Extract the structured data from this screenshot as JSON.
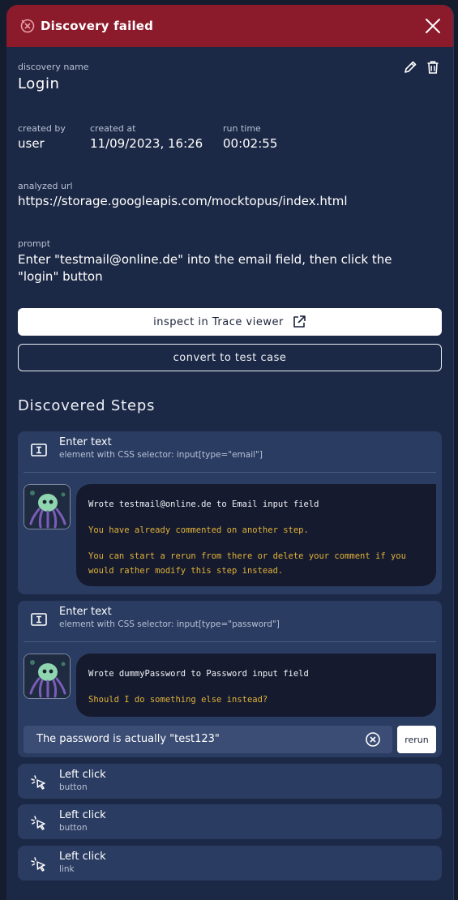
{
  "header": {
    "title": "Discovery failed",
    "fail_icon": "failed-circle-icon",
    "close_icon": "close-icon"
  },
  "discovery": {
    "name_label": "discovery name",
    "name": "Login",
    "created_by_label": "created by",
    "created_by": "user",
    "created_at_label": "created at",
    "created_at": "11/09/2023, 16:26",
    "run_time_label": "run time",
    "run_time": "00:02:55",
    "url_label": "analyzed url",
    "url": "https://storage.googleapis.com/mocktopus/index.html",
    "prompt_label": "prompt",
    "prompt": "Enter \"testmail@online.de\" into the email field, then click the \"login\" button"
  },
  "actions": {
    "inspect_label": "inspect in Trace viewer",
    "convert_label": "convert to test case"
  },
  "section_title": "Discovered Steps",
  "steps": [
    {
      "title": "Enter text",
      "subtitle": "element with CSS selector: input[type=\"email\"]",
      "icon": "text-input-icon",
      "message": "Wrote testmail@online.de to Email input field",
      "warn1": "You have already commented on another step.",
      "warn2": "You can start a rerun from there or delete your comment if you would rather modify this step instead."
    },
    {
      "title": "Enter text",
      "subtitle": "element with CSS selector: input[type=\"password\"]",
      "icon": "text-input-icon",
      "message": "Wrote dummyPassword to Password input field",
      "warn1": "Should I do something else instead?",
      "comment": "The password is actually \"test123\"",
      "rerun_label": "rerun"
    },
    {
      "title": "Left click",
      "subtitle": "button",
      "icon": "click-cursor-icon"
    },
    {
      "title": "Left click",
      "subtitle": "button",
      "icon": "click-cursor-icon"
    },
    {
      "title": "Left click",
      "subtitle": "link",
      "icon": "click-cursor-icon"
    }
  ],
  "colors": {
    "header_bg": "#8b1a2b",
    "panel_bg": "#1c2946",
    "step_bg": "#2a3c62",
    "warn_text": "#e0b23a"
  }
}
